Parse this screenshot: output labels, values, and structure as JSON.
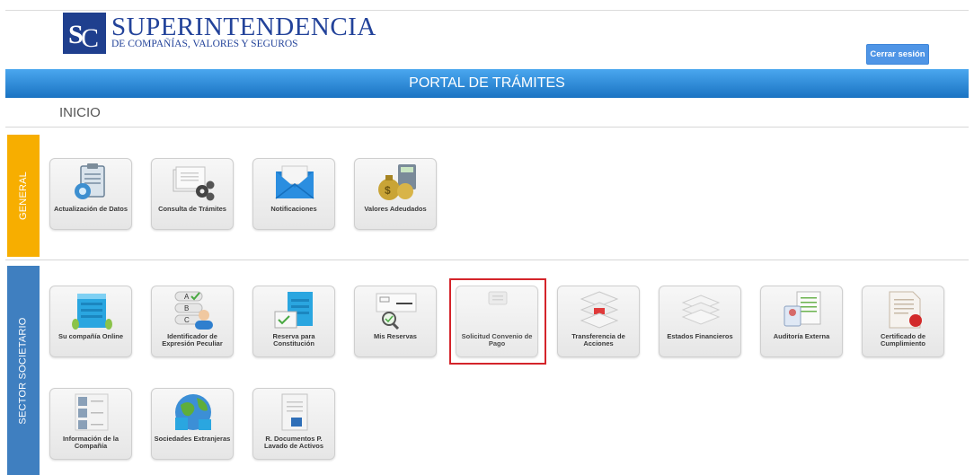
{
  "header": {
    "brand_title": "SUPERINTENDENCIA",
    "brand_subtitle": "DE COMPAÑÍAS, VALORES Y SEGUROS",
    "logout_label": "Cerrar sesión"
  },
  "banner": {
    "title": "PORTAL DE TRÁMITES"
  },
  "breadcrumb": {
    "label": "INICIO"
  },
  "sections": {
    "general": {
      "label": "GENERAL",
      "color": "#f7ae00",
      "tiles": [
        {
          "label": "Actualización de Datos",
          "icon": "clipboard-icon"
        },
        {
          "label": "Consulta de Trámites",
          "icon": "documents-gears-icon"
        },
        {
          "label": "Notificaciones",
          "icon": "envelope-icon"
        },
        {
          "label": "Valores Adeudados",
          "icon": "money-bags-calculator-icon"
        }
      ]
    },
    "societario": {
      "label": "SECTOR SOCIETARIO",
      "color": "#3f7fc0",
      "tiles": [
        {
          "label": "Su compañía Online",
          "icon": "building-icon"
        },
        {
          "label": "Identificador de Expresión Peculiar",
          "icon": "abc-checklist-user-icon"
        },
        {
          "label": "Reserva para Constitución",
          "icon": "building-document-icon"
        },
        {
          "label": "Mis Reservas",
          "icon": "magnifier-card-icon"
        },
        {
          "label": "Solicitud Convenio de Pago",
          "icon": "agreement-icon"
        },
        {
          "label": "Transferencia de Acciones",
          "icon": "stacked-shares-icon"
        },
        {
          "label": "Estados Financieros",
          "icon": "paper-stack-icon"
        },
        {
          "label": "Auditoría Externa",
          "icon": "id-badge-document-icon"
        },
        {
          "label": "Certificado de Cumplimiento",
          "icon": "certificate-seal-icon"
        },
        {
          "label": "Información de la Compañía",
          "icon": "people-list-icon"
        },
        {
          "label": "Sociedades Extranjeras",
          "icon": "globe-buildings-icon"
        },
        {
          "label": "R. Documentos P. Lavado de Activos",
          "icon": "document-report-icon"
        }
      ]
    }
  },
  "colors": {
    "banner": "#1f86d6",
    "highlight": "#d4242a",
    "logout": "#4f95e6",
    "brand": "#23439a"
  }
}
